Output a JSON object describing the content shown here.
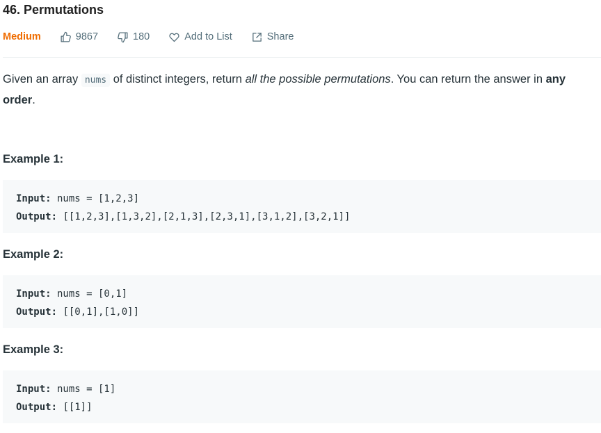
{
  "problem": {
    "title": "46. Permutations",
    "difficulty": "Medium",
    "likes": "9867",
    "dislikes": "180",
    "add_to_list": "Add to List",
    "share": "Share"
  },
  "description": {
    "part1": "Given an array ",
    "code": "nums",
    "part2": " of distinct integers, return ",
    "emphasis": "all the possible permutations",
    "part3": ". You can return the answer in ",
    "strong": "any order",
    "part4": "."
  },
  "examples": [
    {
      "title": "Example 1:",
      "input_label": "Input:",
      "input_value": " nums = [1,2,3]",
      "output_label": "Output:",
      "output_value": " [[1,2,3],[1,3,2],[2,1,3],[2,3,1],[3,1,2],[3,2,1]]"
    },
    {
      "title": "Example 2:",
      "input_label": "Input:",
      "input_value": " nums = [0,1]",
      "output_label": "Output:",
      "output_value": " [[0,1],[1,0]]"
    },
    {
      "title": "Example 3:",
      "input_label": "Input:",
      "input_value": " nums = [1]",
      "output_label": "Output:",
      "output_value": " [[1]]"
    }
  ],
  "colors": {
    "difficulty_medium": "#ef6c00",
    "meta_text": "#546e7a",
    "code_background": "#f7f9fa",
    "text": "#263238"
  },
  "icons": {
    "like": "thumbs-up-icon",
    "dislike": "thumbs-down-icon",
    "add_to_list": "heart-icon",
    "share": "share-icon"
  }
}
